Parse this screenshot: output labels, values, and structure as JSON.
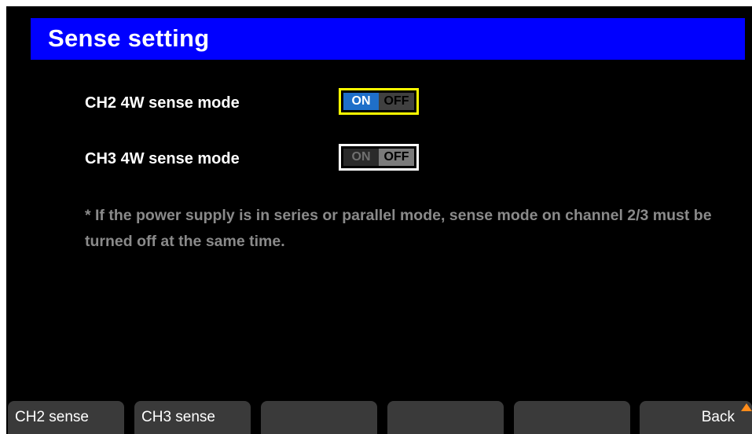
{
  "title": "Sense setting",
  "settings": [
    {
      "label": "CH2 4W sense mode",
      "on_label": "ON",
      "off_label": "OFF",
      "state": "ON",
      "focused": true
    },
    {
      "label": "CH3 4W sense mode",
      "on_label": "ON",
      "off_label": "OFF",
      "state": "OFF",
      "focused": false
    }
  ],
  "note": "* If the power supply is in series or parallel mode, sense mode on channel 2/3 must be turned off at the same time.",
  "softkeys": [
    "CH2 sense",
    "CH3 sense",
    "",
    "",
    "",
    "Back"
  ],
  "colors": {
    "title_bar": "#0000ff",
    "focus_border": "#ffff00",
    "on_active": "#1f6fc9",
    "corner_arrow": "#ff8c1a"
  }
}
